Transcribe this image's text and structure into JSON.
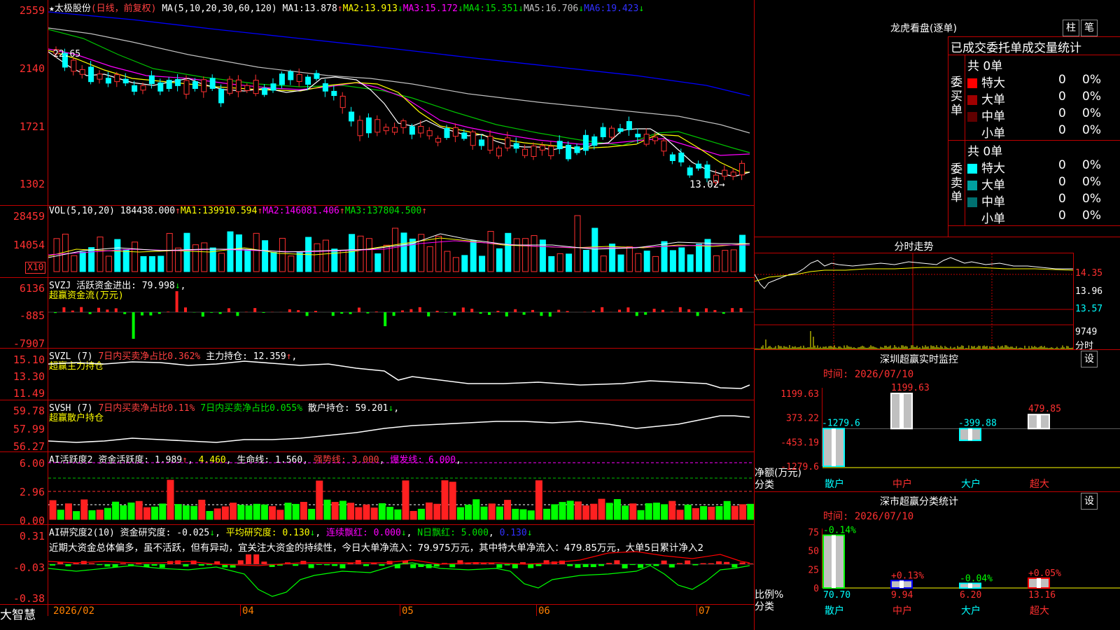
{
  "brand": "大智慧",
  "colors": {
    "up": "#ff3030",
    "down": "#00ffff",
    "ma1": "#ffffff",
    "ma2": "#ffff00",
    "ma3": "#ff00ff",
    "ma4": "#00d000",
    "ma5": "#c0c0c0",
    "ma6": "#0000ff"
  },
  "main": {
    "title": "★太极股份",
    "mode": "(日线，前复权)",
    "ma_label": "MA(5,10,20,30,60,120)",
    "ma": [
      {
        "k": "MA1:",
        "v": "13.878",
        "arrow": "↑"
      },
      {
        "k": "MA2:",
        "v": "13.913",
        "arrow": "↓"
      },
      {
        "k": "MA3:",
        "v": "15.172",
        "arrow": "↓"
      },
      {
        "k": "MA4:",
        "v": "15.351",
        "arrow": "↓"
      },
      {
        "k": "MA5:",
        "v": "16.706",
        "arrow": "↓"
      },
      {
        "k": "MA6:",
        "v": "19.423",
        "arrow": "↓"
      }
    ],
    "yticks": [
      "2559",
      "2140",
      "1721",
      "1302"
    ],
    "high_mark": "22.65",
    "low_mark": "13.02→"
  },
  "vol": {
    "label": "VOL(5,10,20)",
    "value": "184438.000",
    "arrow": "↑",
    "ma": [
      {
        "k": "MA1:",
        "v": "139910.594",
        "arrow": "↑"
      },
      {
        "k": "MA2:",
        "v": "146081.406",
        "arrow": "↑"
      },
      {
        "k": "MA3:",
        "v": "137804.500",
        "arrow": "↑"
      }
    ],
    "yticks": [
      "28459",
      "14054"
    ],
    "unit": "X10"
  },
  "svzj": {
    "label": "SVZJ  活跃资金进出:",
    "value": "79.998",
    "arrow": "↓",
    "sub": "超赢资金流(万元)",
    "yticks": [
      "6136",
      "-885",
      "-7907"
    ]
  },
  "svzl": {
    "label": "SVZL (7)",
    "l2": "7日内买卖净占比0.362%",
    "l3": "主力持仓:",
    "v3": "12.359",
    "arrow": "↑",
    "sub": "超赢主力持仓",
    "yticks": [
      "15.10",
      "13.30",
      "11.49"
    ]
  },
  "svsh": {
    "label": "SVSH (7)",
    "l2": "7日内买卖净占比0.11%",
    "l3": "7日内买卖净占比0.055%",
    "l4": "散户持仓:",
    "v4": "59.201",
    "arrow": "↓",
    "sub": "超赢散户持仓",
    "yticks": [
      "59.78",
      "57.99",
      "56.27"
    ]
  },
  "ai1": {
    "label": "AI活跃度2",
    "k1": "资金活跃度:",
    "v1": "1.989",
    "a1": "↑",
    "v2": "4.460",
    "k3": "生命线:",
    "v3": "1.560",
    "k4": "强势线:",
    "v4": "3.000",
    "k5": "爆发线:",
    "v5": "6.000",
    "yticks": [
      "6.00",
      "2.96",
      "0.00"
    ]
  },
  "ai2": {
    "label": "AI研究度2(10)",
    "k1": "资金研究度:",
    "v1": "-0.025",
    "a1": "↓",
    "k2": "平均研究度:",
    "v2": "0.130",
    "a2": "↓",
    "k3": "连续飘红:",
    "v3": "0.000",
    "a3": "↓",
    "k4": "N日飘红:",
    "v4": "5.000",
    "v5": "0.130",
    "a5": "↓",
    "text": "近期大资金总体偏多，虽不活跃，但有异动，宜关注大资金的持续性，今日大单净流入：79.975万元，其中特大单净流入：479.85万元，大单5日累计净入2",
    "yticks": [
      "0.31",
      "-0.03",
      "-0.38"
    ]
  },
  "xaxis": [
    "2026/02",
    "04",
    "05",
    "06",
    "07"
  ],
  "lhkp": {
    "title": "龙虎看盘(逐单)",
    "btn1": "柱",
    "btn2": "笔",
    "subtitle": "已成交委托单成交量统计",
    "buy": {
      "side": "委买单",
      "total": "共 0单",
      "rows": [
        {
          "name": "特大",
          "n": "0",
          "p": "0%"
        },
        {
          "name": "大单",
          "n": "0",
          "p": "0%"
        },
        {
          "name": "中单",
          "n": "0",
          "p": "0%"
        },
        {
          "name": "小单",
          "n": "0",
          "p": "0%"
        }
      ]
    },
    "sell": {
      "side": "委卖单",
      "total": "共 0单",
      "rows": [
        {
          "name": "特大",
          "n": "0",
          "p": "0%"
        },
        {
          "name": "大单",
          "n": "0",
          "p": "0%"
        },
        {
          "name": "中单",
          "n": "0",
          "p": "0%"
        },
        {
          "name": "小单",
          "n": "0",
          "p": "0%"
        }
      ]
    }
  },
  "fenshi": {
    "title": "分时走势",
    "p1": "14.35",
    "p2": "13.96",
    "p3": "13.57",
    "vol": "9749",
    "unit": "分时"
  },
  "szjk": {
    "title": "深圳超赢实时监控",
    "btn": "设",
    "time": "时间: 2026/07/10",
    "yticks": [
      "1199.63",
      "373.22",
      "-453.19",
      "-1279.6"
    ],
    "unit": "净额(万元)",
    "xlabel": "分类",
    "bars": [
      {
        "name": "散户",
        "value": -1279.6,
        "label": "-1279.6"
      },
      {
        "name": "中户",
        "value": 1199.63,
        "label": "1199.63"
      },
      {
        "name": "大户",
        "value": -399.88,
        "label": "-399.88"
      },
      {
        "name": "超大",
        "value": 479.85,
        "label": "479.85"
      }
    ]
  },
  "sstj": {
    "title": "深市超赢分类统计",
    "btn": "设",
    "time": "时间: 2026/07/10",
    "yticks": [
      "75",
      "50",
      "25",
      "0"
    ],
    "unit": "比例%",
    "xlabel": "分类",
    "bars": [
      {
        "name": "散户",
        "value": 70.7,
        "label": "70.70",
        "delta": "-0.14%"
      },
      {
        "name": "中户",
        "value": 9.94,
        "label": "9.94",
        "delta": "+0.13%"
      },
      {
        "name": "大户",
        "value": 6.2,
        "label": "6.20",
        "delta": "-0.04%"
      },
      {
        "name": "超大",
        "value": 13.16,
        "label": "13.16",
        "delta": "+0.05%"
      }
    ]
  }
}
